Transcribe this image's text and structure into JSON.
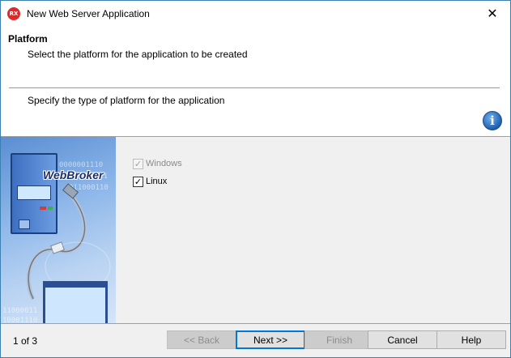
{
  "window": {
    "title": "New Web Server Application",
    "app_icon_text": "RX",
    "close_glyph": "✕"
  },
  "header": {
    "title": "Platform",
    "subtitle": "Select the platform for the application to be created",
    "description": "Specify the type of platform for the application"
  },
  "image": {
    "brand": "WebBroker",
    "binary_lines": [
      "0000001110",
      "1011100111",
      "011000110",
      "11000011",
      "10001110"
    ]
  },
  "platforms": [
    {
      "label": "Windows",
      "checked": true,
      "enabled": false
    },
    {
      "label": "Linux",
      "checked": true,
      "enabled": true
    }
  ],
  "footer": {
    "page_indicator": "1 of 3",
    "back_label": "<< Back",
    "next_label": "Next >>",
    "finish_label": "Finish",
    "cancel_label": "Cancel",
    "help_label": "Help"
  },
  "colors": {
    "accent": "#0078d7",
    "info_icon": "#1f5fae",
    "app_icon": "#e0282a"
  }
}
